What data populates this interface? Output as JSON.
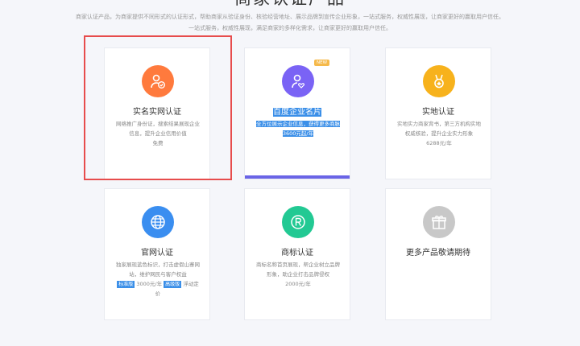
{
  "page": {
    "title": "商家认证产品",
    "intro_line1": "商家认证产品，为商家提供不同形式的认证形式，帮助商家从验证身份、核验经营地址、展示品牌到宣传企业形象，一站式服务，权威性展现，让商家更好的赢取用户信任。",
    "intro_line2": "一站式服务，权威性展现，满足商家的多样化需求，让商家更好的赢取用户信任。"
  },
  "cards": [
    {
      "title": "实名实网认证",
      "desc": "网络推广身份证，搜索结果展现企业信息，提升企业信用价值",
      "price": "免费",
      "icon": "user-check-icon",
      "color": "#ff7a3d"
    },
    {
      "title": "百度企业名片",
      "desc": "全方位展示企业信息，获得更多商脉",
      "price": "3600元起/年",
      "badge": "NEW",
      "icon": "user-heart-icon",
      "color": "#7a63f5"
    },
    {
      "title": "实地认证",
      "desc": "实地实力商家背书，第三方机构实地权威核验，提升企业实力形象",
      "price": "6288元/年",
      "icon": "medal-icon",
      "color": "#f7b21c"
    },
    {
      "title": "官网认证",
      "desc": "独家展现蓝色标识，打击虚假山寨网站，维护网民与客户权益",
      "tag1": "标准版",
      "price1": "3000元/年",
      "tag2": "高级版",
      "price2": "浮动定价",
      "icon": "globe-icon",
      "color": "#3a8ef0"
    },
    {
      "title": "商标认证",
      "desc": "商标名称首页展现，帮企业树立品牌形象，助企业打击品牌侵权",
      "price": "2000元/年",
      "icon": "registered-icon",
      "color": "#22c993"
    },
    {
      "title": "更多产品敬请期待",
      "icon": "gift-icon",
      "color": "#c8c8c8"
    }
  ]
}
